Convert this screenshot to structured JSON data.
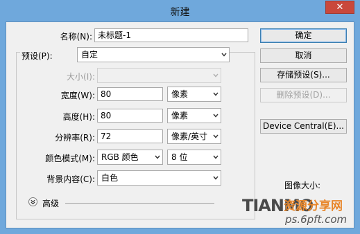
{
  "window": {
    "title": "新建",
    "close_glyph": "✕"
  },
  "form": {
    "name_label": "名称(N):",
    "name_value": "未标题-1",
    "preset_label": "预设(P):",
    "preset_value": "自定",
    "size_label": "大小(I):",
    "size_value": "",
    "width_label": "宽度(W):",
    "width_value": "80",
    "width_unit": "像素",
    "height_label": "高度(H):",
    "height_value": "80",
    "height_unit": "像素",
    "resolution_label": "分辨率(R):",
    "resolution_value": "72",
    "resolution_unit": "像素/英寸",
    "color_mode_label": "颜色模式(M):",
    "color_mode_value": "RGB 颜色",
    "bit_depth_value": "8 位",
    "background_label": "背景内容(C):",
    "background_value": "白色",
    "advanced_label": "高级"
  },
  "buttons": {
    "ok": "确定",
    "cancel": "取消",
    "save_preset": "存储预设(S)...",
    "delete_preset": "删除预设(D)...",
    "device_central": "Device Central(E)..."
  },
  "side": {
    "image_size_label": "图像大小:"
  },
  "watermark": {
    "text_left": "TIANMO",
    "text_cn": "资源分享网",
    "text_url": "ps.6pft.com"
  },
  "colors": {
    "title_bar": "#6fa8dc",
    "dialog_bg": "#f0f0f0",
    "close_button": "#c9483b",
    "watermark_orange": "#e8862a"
  }
}
